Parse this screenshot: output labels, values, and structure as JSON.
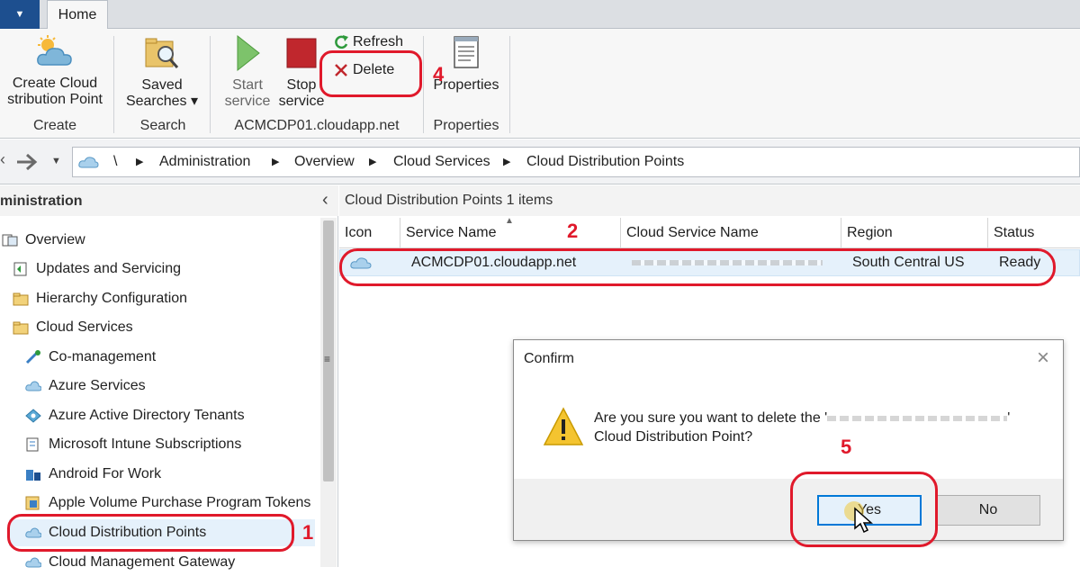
{
  "tabs": {
    "home": "Home"
  },
  "ribbon": {
    "create_cloud_dp": {
      "line1": "Create Cloud",
      "line2": "stribution Point"
    },
    "saved_searches": {
      "line1": "Saved",
      "line2": "Searches ▾"
    },
    "start_service": {
      "line1": "Start",
      "line2": "service"
    },
    "stop_service": {
      "line1": "Stop",
      "line2": "service"
    },
    "refresh": "Refresh",
    "delete": "Delete",
    "properties": "Properties",
    "groups": {
      "create": "Create",
      "search": "Search",
      "server": "ACMCDP01.cloudapp.net",
      "properties": "Properties"
    }
  },
  "breadcrumb": {
    "root": "\\",
    "items": [
      "Administration",
      "Overview",
      "Cloud Services",
      "Cloud Distribution Points"
    ]
  },
  "navigation": {
    "title": "ministration",
    "collapse": "‹",
    "items": [
      "Overview",
      "Updates and Servicing",
      "Hierarchy Configuration",
      "Cloud Services",
      "Co-management",
      "Azure Services",
      "Azure Active Directory Tenants",
      "Microsoft Intune Subscriptions",
      "Android For Work",
      "Apple Volume Purchase Program Tokens",
      "Cloud Distribution Points",
      "Cloud Management Gateway"
    ]
  },
  "list": {
    "title": "Cloud Distribution Points 1 items",
    "columns": [
      "Icon",
      "Service Name",
      "Cloud Service Name",
      "Region",
      "Status"
    ],
    "rows": [
      {
        "service_name": "ACMCDP01.cloudapp.net",
        "cloud_service_name": "",
        "region": "South Central US",
        "status": "Ready"
      }
    ]
  },
  "dialog": {
    "title": "Confirm",
    "close": "×",
    "message_line1": "Are you sure you want to delete the '",
    "message_line1_end": "'",
    "message_line2": "Cloud Distribution Point?",
    "yes": "Yes",
    "no": "No"
  },
  "annotations": [
    "1",
    "2",
    "4",
    "5"
  ],
  "colors": {
    "annotation": "#e0192b",
    "selection": "#e5f1fb",
    "app_menu": "#1d4f8f"
  }
}
